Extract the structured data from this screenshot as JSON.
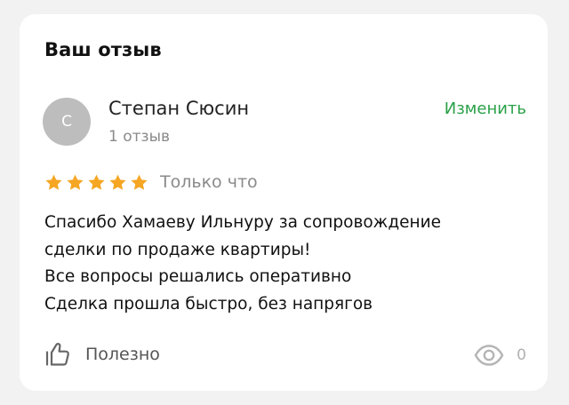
{
  "card": {
    "title": "Ваш отзыв"
  },
  "author": {
    "avatar_letter": "С",
    "name": "Степан Сюсин",
    "reviews_count": "1 отзыв"
  },
  "actions": {
    "edit_label": "Изменить",
    "helpful_label": "Полезно",
    "views_count": "0"
  },
  "rating": {
    "stars": 5,
    "max": 5,
    "date": "Только что"
  },
  "review": {
    "lines": [
      "Спасибо Хамаеву Ильнуру за сопровождение",
      "сделки по продаже квартиры!",
      "Все вопросы решались оперативно",
      "Сделка прошла быстро, без напрягов"
    ]
  },
  "colors": {
    "star": "#f5a623",
    "accent": "#2aa14a"
  },
  "icons": {
    "thumbs_up": "thumbs-up-icon",
    "views": "eye-icon"
  }
}
